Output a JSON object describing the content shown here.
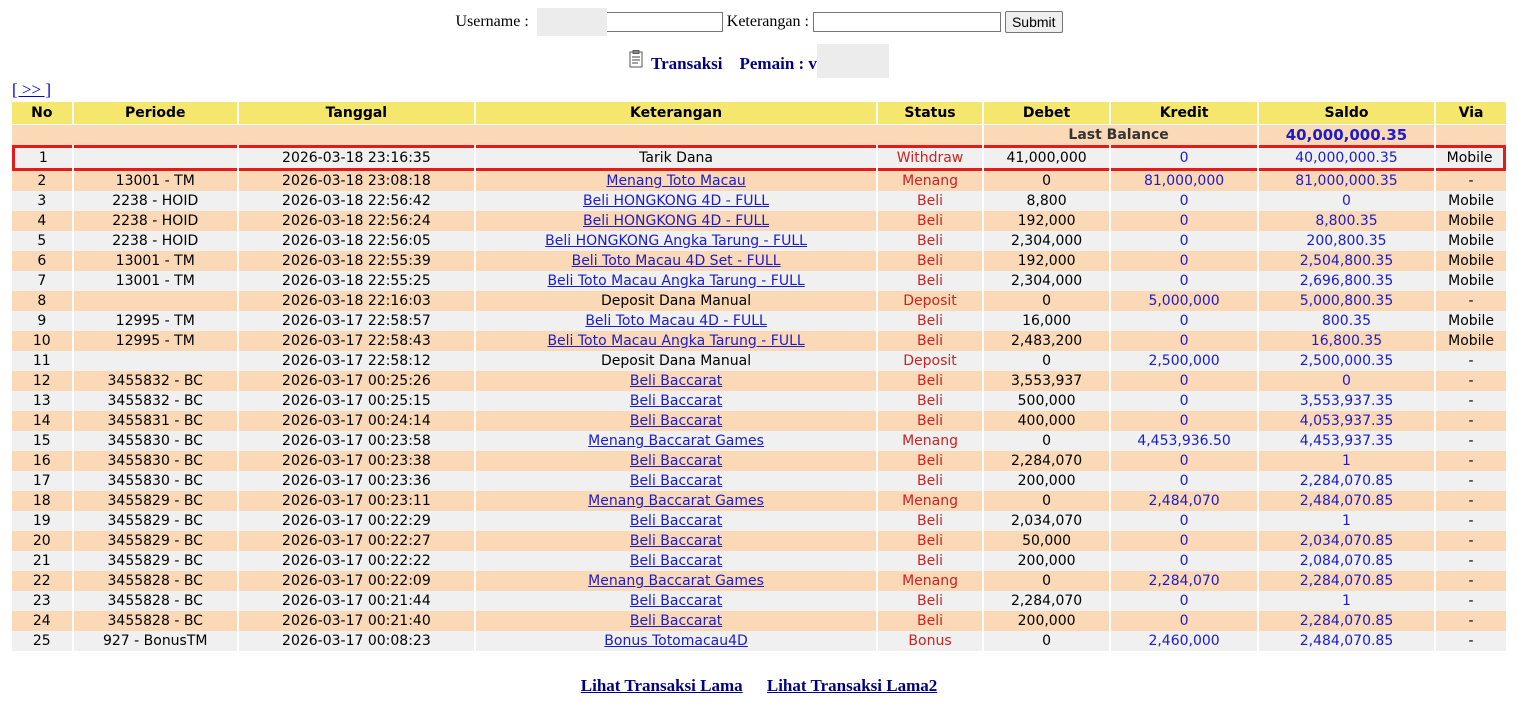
{
  "search": {
    "username_label": "Username :",
    "keterangan_label": "Keterangan :",
    "submit_label": "Submit",
    "username_value": "",
    "keterangan_value": ""
  },
  "title": {
    "transaksi": "Transaksi",
    "pemain_label": "Pemain : v"
  },
  "nav": {
    "next": "[ >> ]"
  },
  "table": {
    "headers": [
      "No",
      "Periode",
      "Tanggal",
      "Keterangan",
      "Status",
      "Debet",
      "Kredit",
      "Saldo",
      "Via"
    ],
    "last_balance_label": "Last Balance",
    "last_balance_value": "40,000,000.35",
    "rows": [
      {
        "no": "1",
        "periode": "",
        "tanggal": "2026-03-18 23:16:35",
        "keterangan": "Tarik Dana",
        "status": "Withdraw",
        "debet": "41,000,000",
        "kredit": "0",
        "saldo": "40,000,000.35",
        "via": "Mobile"
      },
      {
        "no": "2",
        "periode": "13001 - TM",
        "tanggal": "2026-03-18 23:08:18",
        "keterangan": "Menang Toto Macau",
        "status": "Menang",
        "debet": "0",
        "kredit": "81,000,000",
        "saldo": "81,000,000.35",
        "via": "-"
      },
      {
        "no": "3",
        "periode": "2238 - HOID",
        "tanggal": "2026-03-18 22:56:42",
        "keterangan": "Beli HONGKONG 4D - FULL",
        "status": "Beli",
        "debet": "8,800",
        "kredit": "0",
        "saldo": "0",
        "via": "Mobile"
      },
      {
        "no": "4",
        "periode": "2238 - HOID",
        "tanggal": "2026-03-18 22:56:24",
        "keterangan": "Beli HONGKONG 4D - FULL",
        "status": "Beli",
        "debet": "192,000",
        "kredit": "0",
        "saldo": "8,800.35",
        "via": "Mobile"
      },
      {
        "no": "5",
        "periode": "2238 - HOID",
        "tanggal": "2026-03-18 22:56:05",
        "keterangan": "Beli HONGKONG Angka Tarung - FULL",
        "status": "Beli",
        "debet": "2,304,000",
        "kredit": "0",
        "saldo": "200,800.35",
        "via": "Mobile"
      },
      {
        "no": "6",
        "periode": "13001 - TM",
        "tanggal": "2026-03-18 22:55:39",
        "keterangan": "Beli Toto Macau 4D Set - FULL",
        "status": "Beli",
        "debet": "192,000",
        "kredit": "0",
        "saldo": "2,504,800.35",
        "via": "Mobile"
      },
      {
        "no": "7",
        "periode": "13001 - TM",
        "tanggal": "2026-03-18 22:55:25",
        "keterangan": "Beli Toto Macau Angka Tarung - FULL",
        "status": "Beli",
        "debet": "2,304,000",
        "kredit": "0",
        "saldo": "2,696,800.35",
        "via": "Mobile"
      },
      {
        "no": "8",
        "periode": "",
        "tanggal": "2026-03-18 22:16:03",
        "keterangan": "Deposit Dana Manual",
        "status": "Deposit",
        "debet": "0",
        "kredit": "5,000,000",
        "saldo": "5,000,800.35",
        "via": "-"
      },
      {
        "no": "9",
        "periode": "12995 - TM",
        "tanggal": "2026-03-17 22:58:57",
        "keterangan": "Beli Toto Macau 4D - FULL",
        "status": "Beli",
        "debet": "16,000",
        "kredit": "0",
        "saldo": "800.35",
        "via": "Mobile"
      },
      {
        "no": "10",
        "periode": "12995 - TM",
        "tanggal": "2026-03-17 22:58:43",
        "keterangan": "Beli Toto Macau Angka Tarung - FULL",
        "status": "Beli",
        "debet": "2,483,200",
        "kredit": "0",
        "saldo": "16,800.35",
        "via": "Mobile"
      },
      {
        "no": "11",
        "periode": "",
        "tanggal": "2026-03-17 22:58:12",
        "keterangan": "Deposit Dana Manual",
        "status": "Deposit",
        "debet": "0",
        "kredit": "2,500,000",
        "saldo": "2,500,000.35",
        "via": "-"
      },
      {
        "no": "12",
        "periode": "3455832 - BC",
        "tanggal": "2026-03-17 00:25:26",
        "keterangan": "Beli Baccarat",
        "status": "Beli",
        "debet": "3,553,937",
        "kredit": "0",
        "saldo": "0",
        "via": "-"
      },
      {
        "no": "13",
        "periode": "3455832 - BC",
        "tanggal": "2026-03-17 00:25:15",
        "keterangan": "Beli Baccarat",
        "status": "Beli",
        "debet": "500,000",
        "kredit": "0",
        "saldo": "3,553,937.35",
        "via": "-"
      },
      {
        "no": "14",
        "periode": "3455831 - BC",
        "tanggal": "2026-03-17 00:24:14",
        "keterangan": "Beli Baccarat",
        "status": "Beli",
        "debet": "400,000",
        "kredit": "0",
        "saldo": "4,053,937.35",
        "via": "-"
      },
      {
        "no": "15",
        "periode": "3455830 - BC",
        "tanggal": "2026-03-17 00:23:58",
        "keterangan": "Menang Baccarat Games",
        "status": "Menang",
        "debet": "0",
        "kredit": "4,453,936.50",
        "saldo": "4,453,937.35",
        "via": "-"
      },
      {
        "no": "16",
        "periode": "3455830 - BC",
        "tanggal": "2026-03-17 00:23:38",
        "keterangan": "Beli Baccarat",
        "status": "Beli",
        "debet": "2,284,070",
        "kredit": "0",
        "saldo": "1",
        "via": "-"
      },
      {
        "no": "17",
        "periode": "3455830 - BC",
        "tanggal": "2026-03-17 00:23:36",
        "keterangan": "Beli Baccarat",
        "status": "Beli",
        "debet": "200,000",
        "kredit": "0",
        "saldo": "2,284,070.85",
        "via": "-"
      },
      {
        "no": "18",
        "periode": "3455829 - BC",
        "tanggal": "2026-03-17 00:23:11",
        "keterangan": "Menang Baccarat Games",
        "status": "Menang",
        "debet": "0",
        "kredit": "2,484,070",
        "saldo": "2,484,070.85",
        "via": "-"
      },
      {
        "no": "19",
        "periode": "3455829 - BC",
        "tanggal": "2026-03-17 00:22:29",
        "keterangan": "Beli Baccarat",
        "status": "Beli",
        "debet": "2,034,070",
        "kredit": "0",
        "saldo": "1",
        "via": "-"
      },
      {
        "no": "20",
        "periode": "3455829 - BC",
        "tanggal": "2026-03-17 00:22:27",
        "keterangan": "Beli Baccarat",
        "status": "Beli",
        "debet": "50,000",
        "kredit": "0",
        "saldo": "2,034,070.85",
        "via": "-"
      },
      {
        "no": "21",
        "periode": "3455829 - BC",
        "tanggal": "2026-03-17 00:22:22",
        "keterangan": "Beli Baccarat",
        "status": "Beli",
        "debet": "200,000",
        "kredit": "0",
        "saldo": "2,084,070.85",
        "via": "-"
      },
      {
        "no": "22",
        "periode": "3455828 - BC",
        "tanggal": "2026-03-17 00:22:09",
        "keterangan": "Menang Baccarat Games",
        "status": "Menang",
        "debet": "0",
        "kredit": "2,284,070",
        "saldo": "2,284,070.85",
        "via": "-"
      },
      {
        "no": "23",
        "periode": "3455828 - BC",
        "tanggal": "2026-03-17 00:21:44",
        "keterangan": "Beli Baccarat",
        "status": "Beli",
        "debet": "2,284,070",
        "kredit": "0",
        "saldo": "1",
        "via": "-"
      },
      {
        "no": "24",
        "periode": "3455828 - BC",
        "tanggal": "2026-03-17 00:21:40",
        "keterangan": "Beli Baccarat",
        "status": "Beli",
        "debet": "200,000",
        "kredit": "0",
        "saldo": "2,284,070.85",
        "via": "-"
      },
      {
        "no": "25",
        "periode": "927 - BonusTM",
        "tanggal": "2026-03-17 00:08:23",
        "keterangan": "Bonus Totomacau4D",
        "status": "Bonus",
        "debet": "0",
        "kredit": "2,460,000",
        "saldo": "2,484,070.85",
        "via": "-"
      }
    ]
  },
  "footer": {
    "link1": "Lihat Transaksi Lama",
    "link2": "Lihat Transaksi Lama2"
  },
  "colors": {
    "header_bg": "#f5e66e",
    "row_even": "#fcd9b6",
    "row_odd": "#f0f0f0",
    "status_red": "#cc2222",
    "value_blue": "#1c1cc8",
    "title_navy": "#000080",
    "highlight_border": "#e41b1b"
  },
  "icons": {
    "title_icon": "clipboard-icon"
  }
}
